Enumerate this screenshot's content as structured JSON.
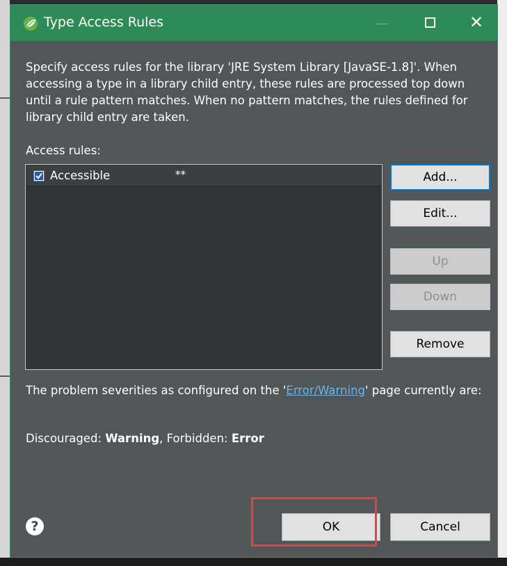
{
  "window": {
    "title": "Type Access Rules",
    "logo_icon": "eclipse-leaf-icon",
    "controls": {
      "minimize": "—",
      "maximize": "□",
      "close": "✕"
    }
  },
  "description": "Specify access rules for the library 'JRE System Library [JavaSE-1.8]'. When accessing a type in a library child entry, these rules are processed top down until a rule pattern matches. When no pattern matches, the rules defined for library child entry are taken.",
  "access_rules": {
    "label": "Access rules:",
    "rows": [
      {
        "checked": true,
        "kind": "Accessible",
        "pattern": "**"
      }
    ]
  },
  "side_buttons": {
    "add": "Add...",
    "edit": "Edit...",
    "up": "Up",
    "down": "Down",
    "remove": "Remove"
  },
  "severity": {
    "text_before": "The problem severities as configured on the '",
    "link": "Error/Warning",
    "text_after": "' page currently are:",
    "discouraged_label": "Discouraged: ",
    "discouraged_value": "Warning",
    "separator": ", Forbidden: ",
    "forbidden_value": "Error"
  },
  "footer": {
    "help": "?",
    "ok": "OK",
    "cancel": "Cancel"
  },
  "colors": {
    "titlebar": "#2e8b57",
    "dialog_bg": "#515658",
    "list_bg": "#2f3436",
    "link": "#6fb3e6",
    "highlight": "#e8403e"
  }
}
